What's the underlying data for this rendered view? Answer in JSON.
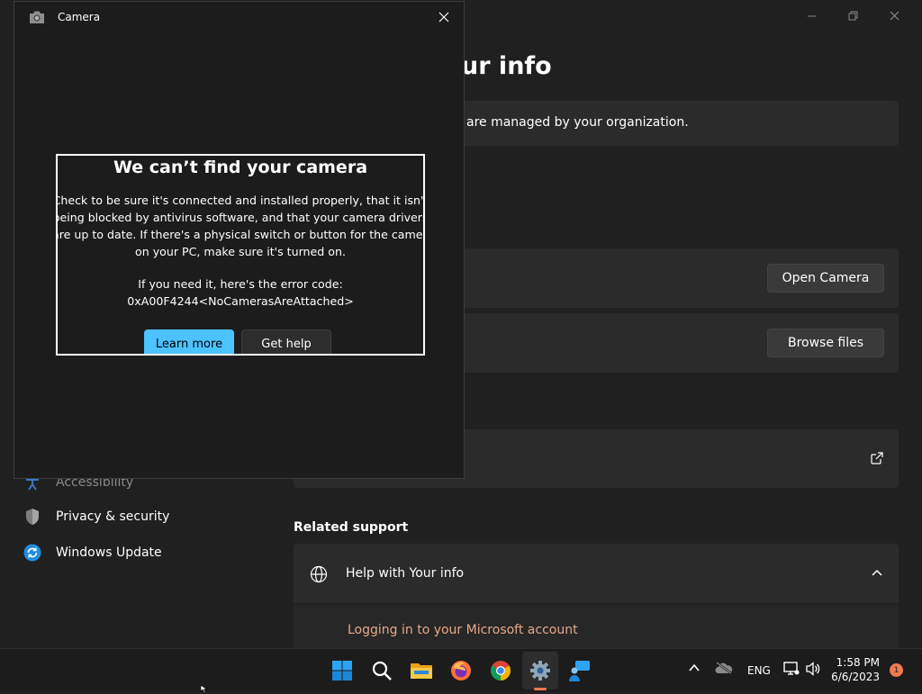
{
  "settings": {
    "page_title": "ur info",
    "org_notice": "are managed by your organization.",
    "open_camera_label": "Open Camera",
    "browse_files_label": "Browse files",
    "related_support_label": "Related support",
    "help_section_label": "Help with Your info",
    "help_link": "Logging in to your Microsoft account",
    "nav": [
      {
        "label": "Accessibility",
        "icon": "accessibility-icon"
      },
      {
        "label": "Privacy & security",
        "icon": "shield-icon"
      },
      {
        "label": "Windows Update",
        "icon": "windows-update-icon"
      }
    ]
  },
  "camera": {
    "window_title": "Camera",
    "error": {
      "title": "We can’t find your camera",
      "body_lines": [
        "Check to be sure it's connected and installed properly, that it isn't",
        "being blocked by antivirus software, and that your camera drivers",
        "are up to date. If there's a physical switch or button for the camera",
        "on your PC, make sure it's turned on."
      ],
      "code_intro": "If you need it, here's the error code:",
      "code": "0xA00F4244<NoCamerasAreAttached>",
      "learn_more_label": "Learn more",
      "get_help_label": "Get help"
    }
  },
  "taskbar": {
    "apps": [
      "start-icon",
      "search-icon",
      "file-explorer-icon",
      "firefox-icon",
      "chrome-icon",
      "settings-icon",
      "feedback-icon"
    ],
    "active_app": "settings-icon",
    "language": "ENG",
    "time": "1:58 PM",
    "date": "6/6/2023",
    "notification_count": "1"
  },
  "colors": {
    "accent": "#4cc2ff",
    "link": "#e6a88a",
    "badge": "#f07a50"
  }
}
